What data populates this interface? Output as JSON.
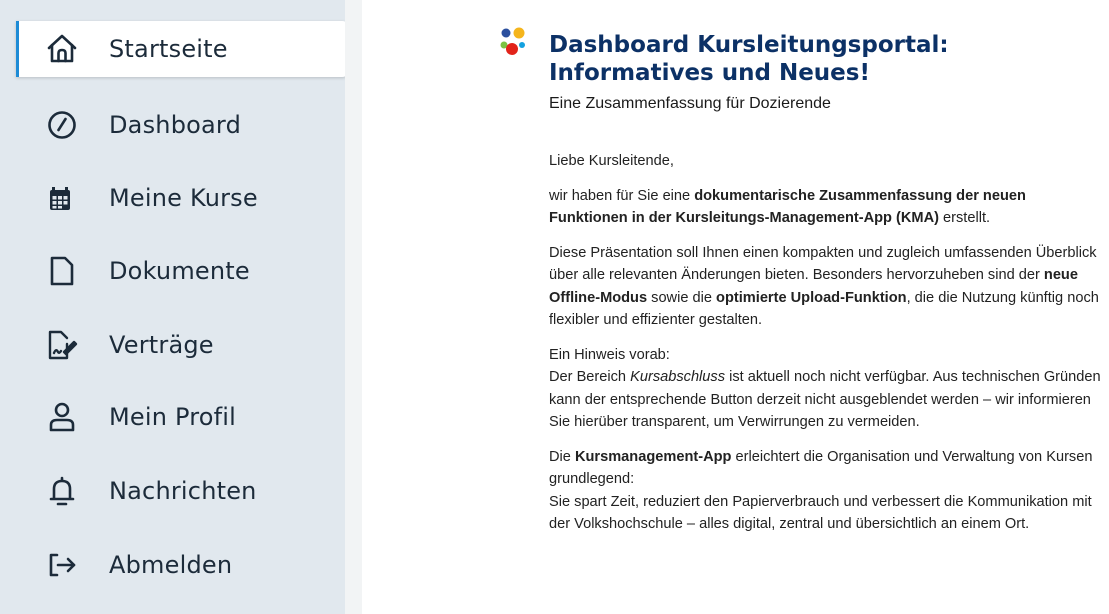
{
  "sidebar": {
    "items": [
      {
        "label": "Startseite",
        "icon": "home-icon",
        "active": true
      },
      {
        "label": "Dashboard",
        "icon": "gauge-icon"
      },
      {
        "label": "Meine Kurse",
        "icon": "calendar-icon"
      },
      {
        "label": "Dokumente",
        "icon": "document-icon"
      },
      {
        "label": "Verträge",
        "icon": "contract-icon"
      },
      {
        "label": "Mein Profil",
        "icon": "profile-icon"
      },
      {
        "label": "Nachrichten",
        "icon": "bell-icon"
      },
      {
        "label": "Abmelden",
        "icon": "logout-icon"
      }
    ]
  },
  "article": {
    "title_line1": "Dashboard Kursleitungsportal:",
    "title_line2": "Informatives und Neues!",
    "subtitle": "Eine Zusammenfassung für Dozierende",
    "greeting": "Liebe Kursleitende,",
    "p1_a": "wir haben für Sie eine ",
    "p1_b": "dokumentarische Zusammenfassung der neuen Funktionen in der Kursleitungs-Management-App (KMA)",
    "p1_c": " erstellt.",
    "p2_a": "Diese Präsentation soll Ihnen einen kompakten und zugleich umfassenden Überblick über alle relevanten Änderungen bieten. Besonders hervorzuheben sind der ",
    "p2_b": "neue Offline-Modus",
    "p2_c": " sowie die ",
    "p2_d": "optimierte Upload-Funktion",
    "p2_e": ", die die Nutzung künftig noch flexibler und effizienter gestalten.",
    "p3_a": "Ein Hinweis vorab:",
    "p3_b": "Der Bereich ",
    "p3_c": "Kursabschluss",
    "p3_d": " ist aktuell noch nicht verfügbar. Aus technischen Gründen kann der entsprechende Button derzeit nicht ausgeblendet werden – wir informieren Sie hierüber transparent, um Verwirrungen zu vermeiden.",
    "p4_a": "Die ",
    "p4_b": "Kursmanagement-App",
    "p4_c": " erleichtert die Organisation und Verwaltung von Kursen grundlegend:",
    "p4_d": "Sie spart Zeit, reduziert den Papierverbrauch und verbessert die Kommunikation mit der Volkshochschule – alles digital, zentral und übersichtlich an einem Ort."
  },
  "colors": {
    "accent": "#1d8bd6",
    "title": "#0c3166",
    "sidebar_bg": "#e1e8ee"
  }
}
